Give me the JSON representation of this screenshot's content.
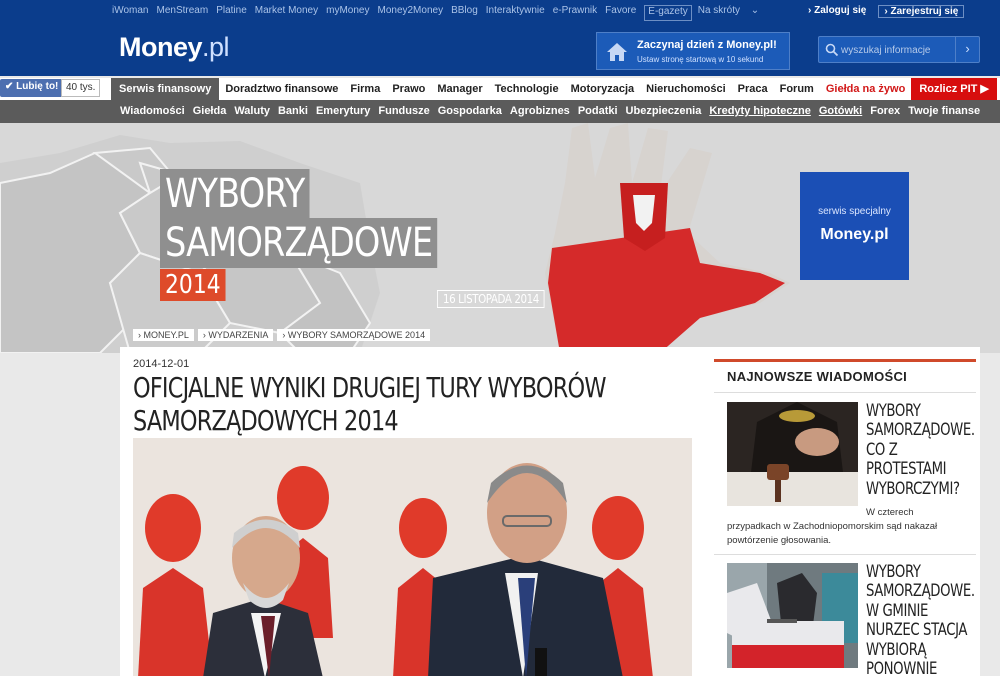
{
  "topbar": {
    "links": [
      "iWoman",
      "MenStream",
      "Platine",
      "Market Money",
      "myMoney",
      "Money2Money",
      "BBlog",
      "Interaktywnie",
      "e-Prawnik",
      "Favore"
    ],
    "egazety": "E-gazety",
    "shortcuts": "Na skróty",
    "login": "Zaloguj się",
    "register": "Zarejestruj się"
  },
  "logo": {
    "main": "Money",
    "suffix": ".pl"
  },
  "promo": {
    "title": "Zaczynaj dzień z Money.pl!",
    "subtitle": "Ustaw stronę startową w 10 sekund"
  },
  "search": {
    "placeholder": "wyszukaj informacje"
  },
  "social": {
    "like": "Lubię to!",
    "count": "40 tys."
  },
  "nav_main": [
    {
      "label": "Serwis finansowy",
      "style": "active"
    },
    {
      "label": "Doradztwo finansowe",
      "style": ""
    },
    {
      "label": "Firma",
      "style": ""
    },
    {
      "label": "Prawo",
      "style": ""
    },
    {
      "label": "Manager",
      "style": ""
    },
    {
      "label": "Technologie",
      "style": ""
    },
    {
      "label": "Motoryzacja",
      "style": ""
    },
    {
      "label": "Nieruchomości",
      "style": ""
    },
    {
      "label": "Praca",
      "style": ""
    },
    {
      "label": "Forum",
      "style": ""
    },
    {
      "label": "Giełda na żywo",
      "style": "red"
    },
    {
      "label": "Rozlicz PIT ▶",
      "style": "redbg"
    }
  ],
  "nav_sub": [
    {
      "label": "Wiadomości",
      "u": false
    },
    {
      "label": "Giełda",
      "u": false
    },
    {
      "label": "Waluty",
      "u": false
    },
    {
      "label": "Banki",
      "u": false
    },
    {
      "label": "Emerytury",
      "u": false
    },
    {
      "label": "Fundusze",
      "u": false
    },
    {
      "label": "Gospodarka",
      "u": false
    },
    {
      "label": "Agrobiznes",
      "u": false
    },
    {
      "label": "Podatki",
      "u": false
    },
    {
      "label": "Ubezpieczenia",
      "u": false
    },
    {
      "label": "Kredyty hipoteczne",
      "u": true
    },
    {
      "label": "Gotówki",
      "u": true
    },
    {
      "label": "Forex",
      "u": false
    },
    {
      "label": "Twoje finanse",
      "u": false
    }
  ],
  "banner": {
    "title_line1": "WYBORY",
    "title_line2": "SAMORZĄDOWE",
    "year": "2014",
    "date": "16 LISTOPADA 2014",
    "special_label": "serwis specjalny",
    "special_brand": "Money.pl",
    "breadcrumbs": [
      "› MONEY.PL",
      "› WYDARZENIA",
      "› WYBORY SAMORZĄDOWE 2014"
    ],
    "colors": {
      "accent": "#de4b2a",
      "special": "#1b4fb5"
    }
  },
  "article": {
    "date": "2014-12-01",
    "title_line1": "OFICJALNE WYNIKI DRUGIEJ TURY WYBORÓW",
    "title_line2": "SAMORZĄDOWYCH 2014"
  },
  "sidebar": {
    "title": "NAJNOWSZE WIADOMOŚCI",
    "items": [
      {
        "headline_lines": [
          "WYBORY",
          "SAMORZĄDOWE.",
          "CO Z",
          "PROTESTAMI",
          "WYBORCZYMI?"
        ],
        "desc_lines": [
          "W czterech",
          "przypadkach w Zachodniopomorskim sąd nakazał",
          "powtórzenie głosowania."
        ]
      },
      {
        "headline_lines": [
          "WYBORY",
          "SAMORZĄDOWE.",
          "W GMINIE",
          "NURZEC STACJA",
          "WYBIORĄ",
          "PONOWNIE"
        ],
        "desc_lines": []
      }
    ]
  }
}
